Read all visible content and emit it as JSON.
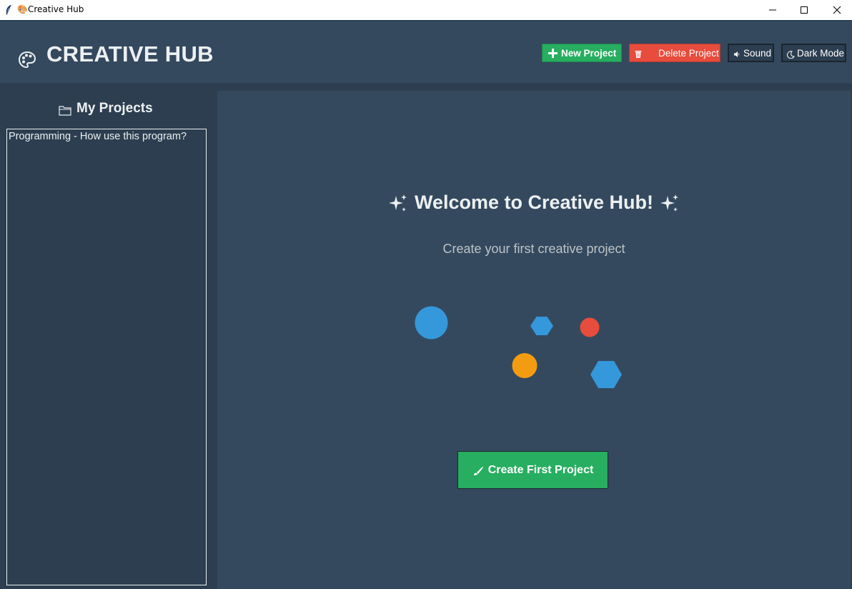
{
  "window": {
    "title": "Creative Hub",
    "icon": "feather-icon",
    "controls": [
      "minimize-icon",
      "maximize-icon",
      "close-icon"
    ]
  },
  "header": {
    "brand_icon": "palette-icon",
    "title": "CREATIVE HUB",
    "buttons": {
      "new_project": {
        "label": "New Project",
        "icon": "plus-icon",
        "color": "#27ae60"
      },
      "delete_project": {
        "label": "Delete Project",
        "icon": "trash-icon",
        "color": "#e74c3c"
      },
      "sound": {
        "label": "Sound",
        "icon": "speaker-icon"
      },
      "dark_mode": {
        "label": "Dark Mode",
        "icon": "moon-icon"
      }
    }
  },
  "sidebar": {
    "icon": "folder-icon",
    "title": "My Projects",
    "projects": [
      "Programming - How use this program?"
    ]
  },
  "main": {
    "welcome_icon": "sparkles-icon",
    "welcome": "Welcome to Creative Hub!",
    "subtitle": "Create your first creative project",
    "create_button": {
      "label": "Create First Project",
      "icon": "brush-icon"
    },
    "decorative_shapes": [
      {
        "shape": "circle",
        "color": "#3498db"
      },
      {
        "shape": "hexagon",
        "color": "#3498db"
      },
      {
        "shape": "circle",
        "color": "#e74c3c"
      },
      {
        "shape": "circle",
        "color": "#f39c12"
      },
      {
        "shape": "hexagon",
        "color": "#3498db"
      }
    ]
  },
  "colors": {
    "background": "#2c3e50",
    "panel": "#34495e",
    "text": "#ecf0f1",
    "muted_text": "#bdc3c7",
    "accent_green": "#27ae60",
    "accent_red": "#e74c3c",
    "accent_blue": "#3498db",
    "accent_orange": "#f39c12"
  }
}
